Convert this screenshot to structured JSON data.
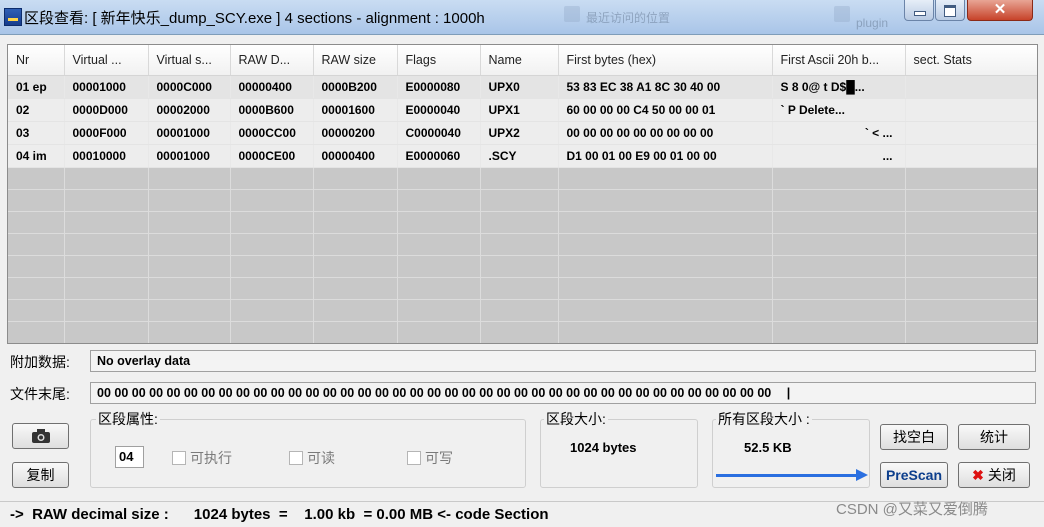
{
  "window": {
    "title": "区段查看: [ 新年快乐_dump_SCY.exe ] 4 sections - alignment : 1000h",
    "background_ghost_texts": [
      "最近访问的位置",
      "plugin"
    ],
    "close_glyph": "✕"
  },
  "table": {
    "columns": [
      "Nr",
      "Virtual ...",
      "Virtual s...",
      "RAW D...",
      "RAW size",
      "Flags",
      "Name",
      "First bytes (hex)",
      "First Ascii 20h b...",
      "sect. Stats"
    ],
    "rows": [
      [
        "01 ep",
        "00001000",
        "0000C000",
        "00000400",
        "0000B200",
        "E0000080",
        "UPX0",
        "53 83 EC 38 A1 8C 30 40 00",
        "S 8 0@  t D$█...",
        ""
      ],
      [
        "02",
        "0000D000",
        "00002000",
        "0000B600",
        "00001600",
        "E0000040",
        "UPX1",
        "60 00 00 00 C4 50 00 00 01",
        "`    P      Delete...",
        ""
      ],
      [
        "03",
        "0000F000",
        "00001000",
        "0000CC00",
        "00000200",
        "C0000040",
        "UPX2",
        "00 00 00 00 00 00 00 00 00",
        "`  <   ...",
        ""
      ],
      [
        "04 im",
        "00010000",
        "00001000",
        "0000CE00",
        "00000400",
        "E0000060",
        ".SCY",
        "D1 00 01 00 E9 00 01 00 00",
        "...",
        ""
      ]
    ]
  },
  "overlay": {
    "label": "附加数据:",
    "value": "No overlay data"
  },
  "eof": {
    "label": "文件末尾:",
    "value": "00 00 00 00 00 00 00 00 00 00 00 00 00 00 00 00 00 00 00 00 00 00 00 00 00 00 00 00 00 00 00 00 00 00 00 00 00 00 00",
    "caret": "|"
  },
  "section_props": {
    "title": "区段属性:",
    "number": "04",
    "executable_label": "可执行",
    "readable_label": "可读",
    "writable_label": "可写"
  },
  "section_size": {
    "title": "区段大小:",
    "value": "1024 bytes"
  },
  "all_sections_size": {
    "title": "所有区段大小 :",
    "value": "52.5 KB"
  },
  "buttons": {
    "copy": "复制",
    "find_empty": "找空白",
    "stats": "统计",
    "prescan": "PreScan",
    "close": "关闭"
  },
  "status": {
    "text": "->  RAW decimal size :      1024 bytes  =    1.00 kb  = 0.00 MB <- code Section",
    "watermark": "CSDN @又菜又爱倒腾"
  },
  "colors": {
    "arrow": "#2a6fe0",
    "grid_empty": "#c8c8c8",
    "close_red": "#c7432a"
  }
}
